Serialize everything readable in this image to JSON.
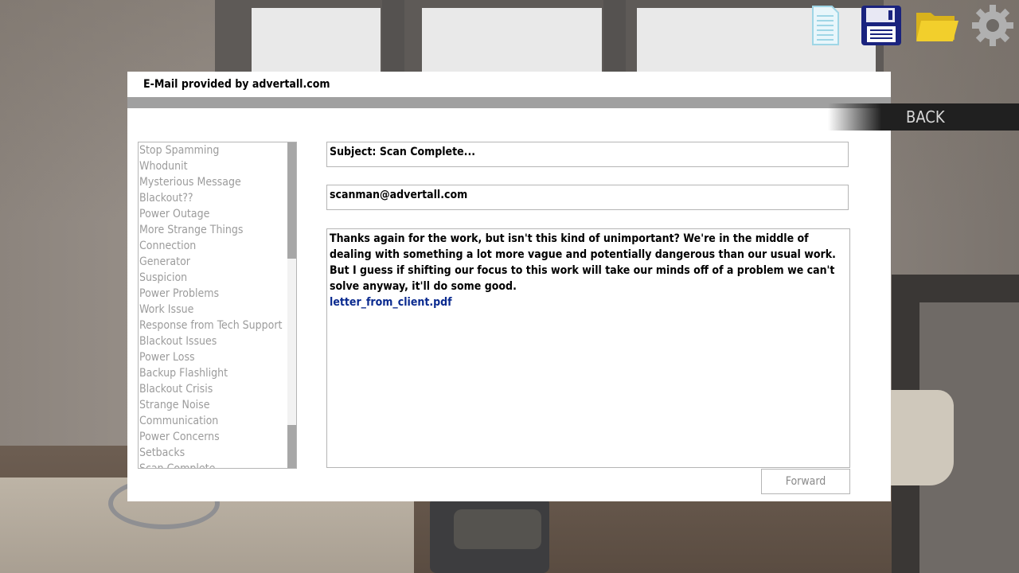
{
  "toolbar": {
    "icons": [
      "document-icon",
      "save-icon",
      "folder-icon",
      "settings-gear-icon"
    ],
    "colors": {
      "document": "#e8f6fb",
      "save": "#1a237e",
      "folder": "#f2cf2c",
      "gear": "#b0b0b0"
    }
  },
  "window": {
    "title": "E-Mail provided by advertall.com"
  },
  "nav": {
    "back_label": "BACK"
  },
  "mail_list": {
    "items": [
      "Stop Spamming",
      "Whodunit",
      "Mysterious Message",
      "Blackout??",
      "Power Outage",
      "More Strange Things",
      "Connection",
      "Generator",
      "Suspicion",
      "Power Problems",
      "Work Issue",
      "Response from Tech Support",
      "Blackout Issues",
      "Power Loss",
      "Backup Flashlight",
      "Blackout Crisis",
      "Strange Noise",
      "Communication",
      "Power Concerns",
      "Setbacks",
      "Scan Complete"
    ]
  },
  "message": {
    "subject": "Subject: Scan Complete...",
    "sender": "scanman@advertall.com",
    "body_line1": "Thanks again for the work, but isn't this kind of unimportant? We're in the middle of dealing with something a lot more vague and potentially dangerous than our usual work.",
    "body_line2": "But I guess if shifting our focus to this work will take our minds off of a problem we can't solve anyway, it'll do some good.",
    "attachment": "letter_from_client.pdf"
  },
  "actions": {
    "forward_label": "Forward"
  }
}
